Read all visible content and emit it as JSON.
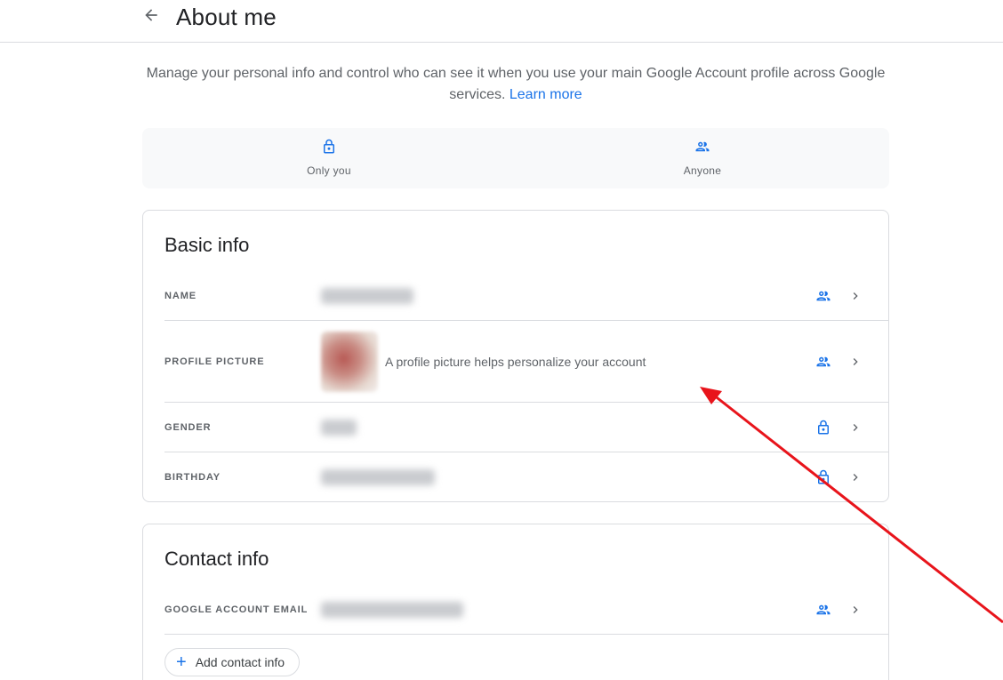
{
  "header": {
    "title": "About me",
    "back_icon": "arrow-back-icon"
  },
  "intro": {
    "text": "Manage your personal info and control who can see it when you use your main Google Account profile across Google services.",
    "link": "Learn more"
  },
  "legend": [
    {
      "label": "Only you",
      "icon": "lock-icon"
    },
    {
      "label": "Anyone",
      "icon": "people-icon"
    }
  ],
  "basic_info": {
    "title": "Basic info",
    "rows": [
      {
        "label": "NAME",
        "visibility": "people-icon"
      },
      {
        "label": "PROFILE PICTURE",
        "description": "A profile picture helps personalize your account",
        "visibility": "people-icon"
      },
      {
        "label": "GENDER",
        "visibility": "lock-icon"
      },
      {
        "label": "BIRTHDAY",
        "visibility": "lock-icon"
      }
    ]
  },
  "contact_info": {
    "title": "Contact info",
    "rows": [
      {
        "label": "GOOGLE ACCOUNT EMAIL",
        "visibility": "people-icon"
      }
    ],
    "add_button": "Add contact info"
  },
  "colors": {
    "accent": "#1a73e8",
    "annotation_arrow": "#e8141b",
    "divider": "#dadce0"
  }
}
